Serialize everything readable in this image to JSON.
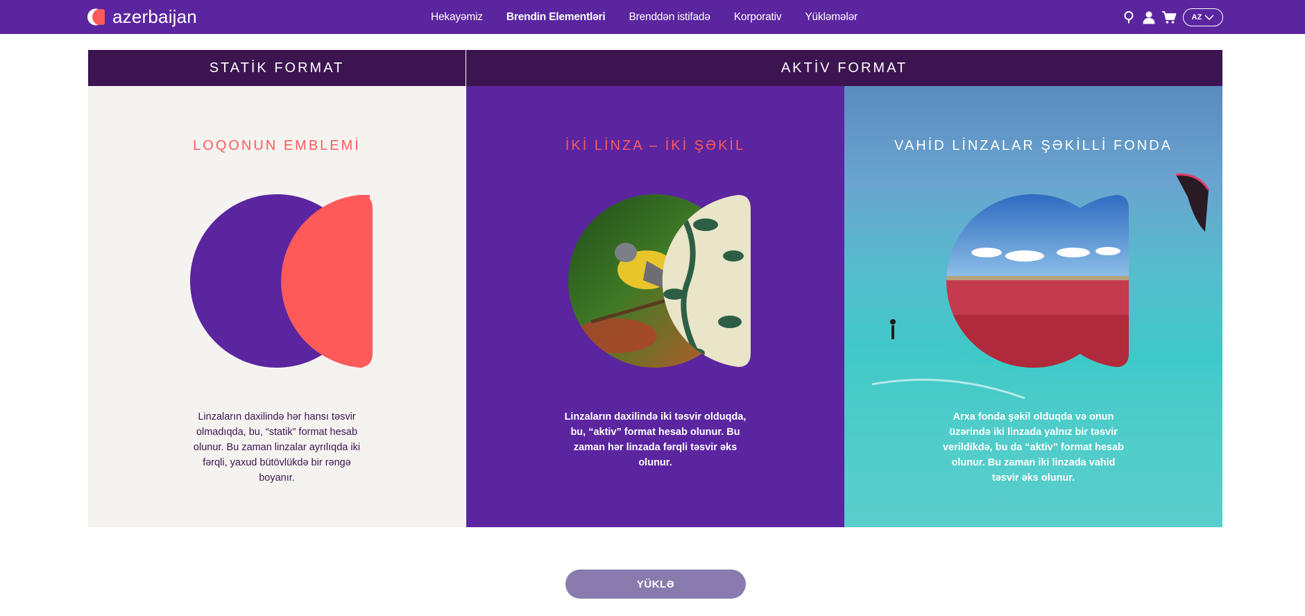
{
  "brand": {
    "name": "azerbaijan",
    "colors": {
      "purple": "#5b25a0",
      "coral": "#ff5a5a",
      "dark": "#3c1450"
    }
  },
  "nav": {
    "items": [
      {
        "label": "Hekayəmiz"
      },
      {
        "label": "Brendin Elementləri",
        "active": true
      },
      {
        "label": "Brenddən istifadə"
      },
      {
        "label": "Korporativ"
      },
      {
        "label": "Yükləmələr"
      }
    ],
    "icons": [
      "search-icon",
      "user-icon",
      "cart-icon"
    ],
    "language": "AZ"
  },
  "headers": {
    "static": "STATİK FORMAT",
    "active": "AKTİV FORMAT"
  },
  "panels": [
    {
      "title": "LOQONUN EMBLEMİ",
      "description": "Linzaların daxilində hər hansı təsvir olmadıqda, bu, “statik” format hesab olunur. Bu zaman linzalar ayrılıqda iki fərqli, yaxud bütövlükdə bir rəngə boyanır."
    },
    {
      "title": "İKİ LİNZA – İKİ ŞƏKİL",
      "description": "Linzaların daxilində iki təsvir olduqda, bu, “aktiv” format hesab olunur. Bu zaman hər linzada fərqli təsvir əks olunur."
    },
    {
      "title": "VAHİD LİNZALAR ŞƏKİLLİ FONDA",
      "description": "Arxa fonda şəkil olduqda və onun üzərində iki linzada yalnız bir təsvir verildikdə, bu da “aktiv” format hesab olunur. Bu zaman iki linzada vahid təsvir əks olunur."
    }
  ],
  "download_button": "YÜKLƏ"
}
